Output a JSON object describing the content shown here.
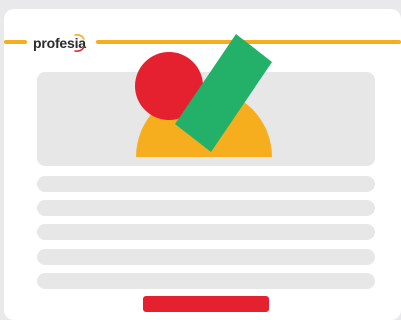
{
  "logo": {
    "text": "profesia"
  },
  "colors": {
    "background": "#e9e9ec",
    "card": "#ffffff",
    "accent_line": "#f6ae1e",
    "placeholder": "#e7e7e8",
    "red": "#e5202f",
    "green": "#23b16a",
    "yellow": "#f6ae1e",
    "button": "#e5202f"
  },
  "hero": {
    "shapes": [
      "red-circle",
      "yellow-half-circle",
      "green-bar"
    ]
  },
  "content": {
    "text_lines": 5
  }
}
